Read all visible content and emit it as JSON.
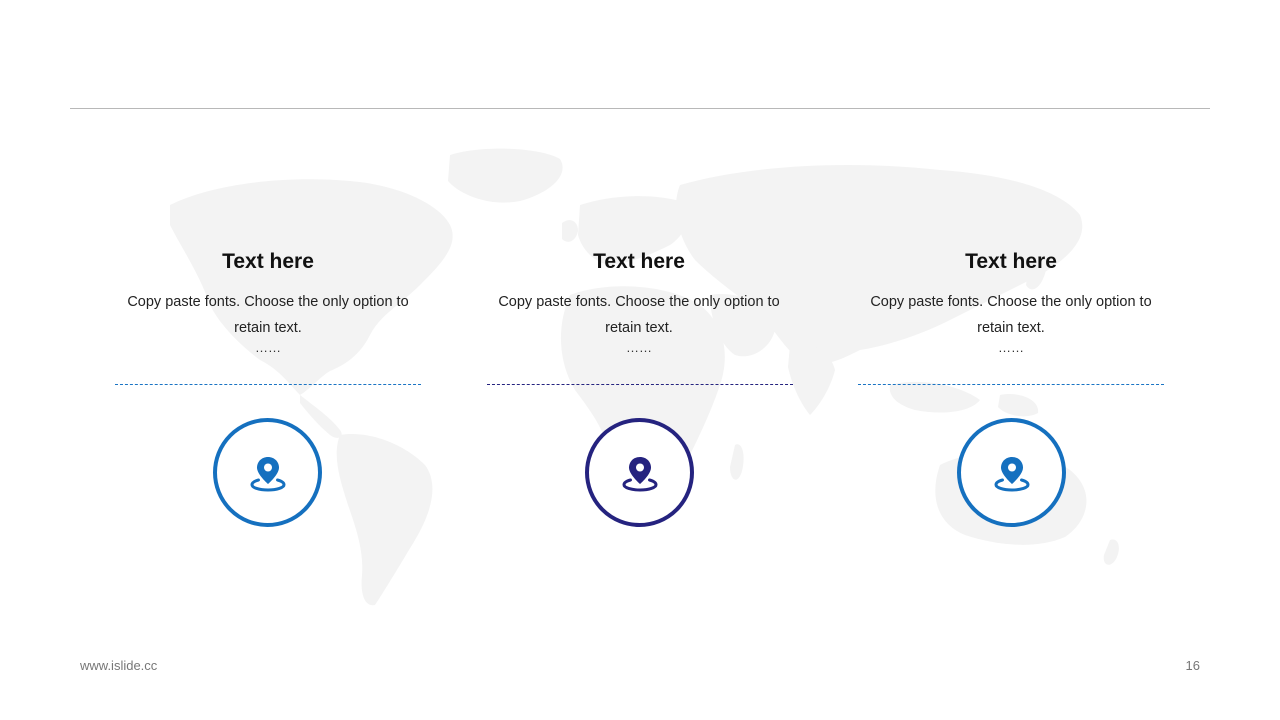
{
  "columns": [
    {
      "title": "Text here",
      "body": "Copy paste fonts. Choose the only option to retain text.",
      "ellipsis": "……",
      "icon": "location-pin-icon",
      "accent_color": "#1570bf"
    },
    {
      "title": "Text here",
      "body": "Copy paste fonts. Choose the only option to retain text.",
      "ellipsis": "……",
      "icon": "location-pin-icon",
      "accent_color": "#25237f"
    },
    {
      "title": "Text here",
      "body": "Copy paste fonts. Choose the only option to retain text.",
      "ellipsis": "……",
      "icon": "location-pin-icon",
      "accent_color": "#1570bf"
    }
  ],
  "footer": {
    "website": "www.islide.cc",
    "page_number": "16"
  },
  "background_icon": "world-map"
}
